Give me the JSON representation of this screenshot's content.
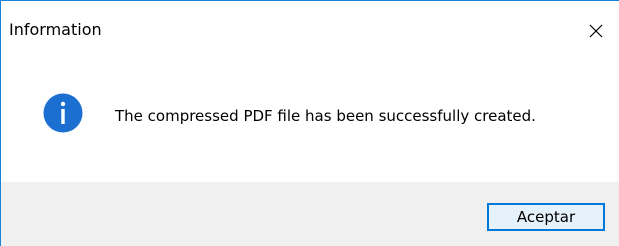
{
  "window": {
    "title": "Information",
    "close_icon": "close-icon"
  },
  "content": {
    "icon": "info-icon",
    "message": "The compressed PDF file has been successfully created."
  },
  "footer": {
    "ok_label": "Aceptar"
  },
  "colors": {
    "border": "#1883d7",
    "icon_fill": "#1a6fd0",
    "footer_bg": "#f0f0f0",
    "button_border": "#0078d7",
    "button_bg": "#e5f1fb"
  }
}
